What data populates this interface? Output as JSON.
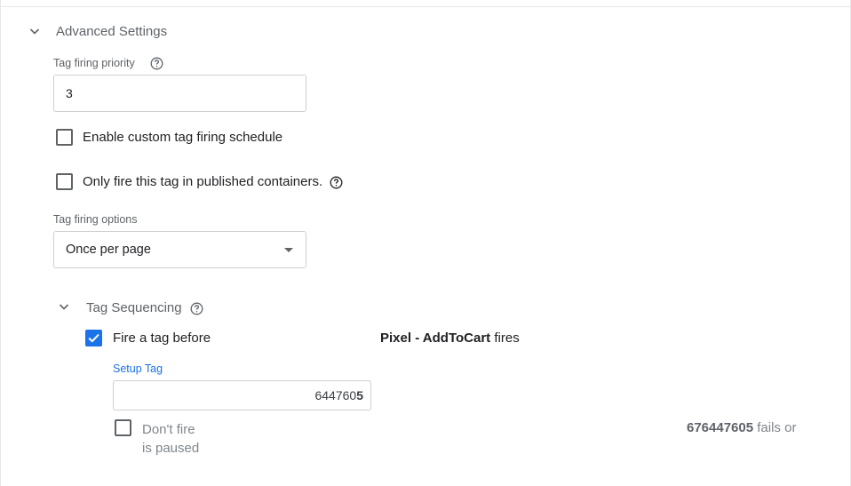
{
  "advanced": {
    "title": "Advanced Settings",
    "priority_label": "Tag firing priority",
    "priority_value": "3",
    "custom_schedule_label": "Enable custom tag firing schedule",
    "custom_schedule_checked": false,
    "published_only_label": "Only fire this tag in published containers.",
    "published_only_checked": false,
    "firing_options_label": "Tag firing options",
    "firing_options_value": "Once per page"
  },
  "sequencing": {
    "title": "Tag Sequencing",
    "fire_before_label": "Fire a tag before",
    "fire_before_checked": true,
    "tag_name_bold": "Pixel - AddToCart",
    "tag_name_suffix": " fires",
    "setup_tag_label": "Setup Tag",
    "setup_tag_value": "644760",
    "setup_tag_cursor": "‹",
    "dont_fire_line1": "Don't fire",
    "dont_fire_line2": "is paused",
    "dont_fire_checked": false,
    "fails_id": "676447605",
    "fails_suffix": " fails or"
  },
  "colors": {
    "accent": "#1a73e8",
    "muted_text": "#5f6368",
    "border": "#cfcfcf"
  },
  "icons": {
    "section_chevron": "chevron-down-icon",
    "help": "help-circle-icon",
    "check": "checkmark-icon",
    "dropdown": "caret-down-icon"
  }
}
